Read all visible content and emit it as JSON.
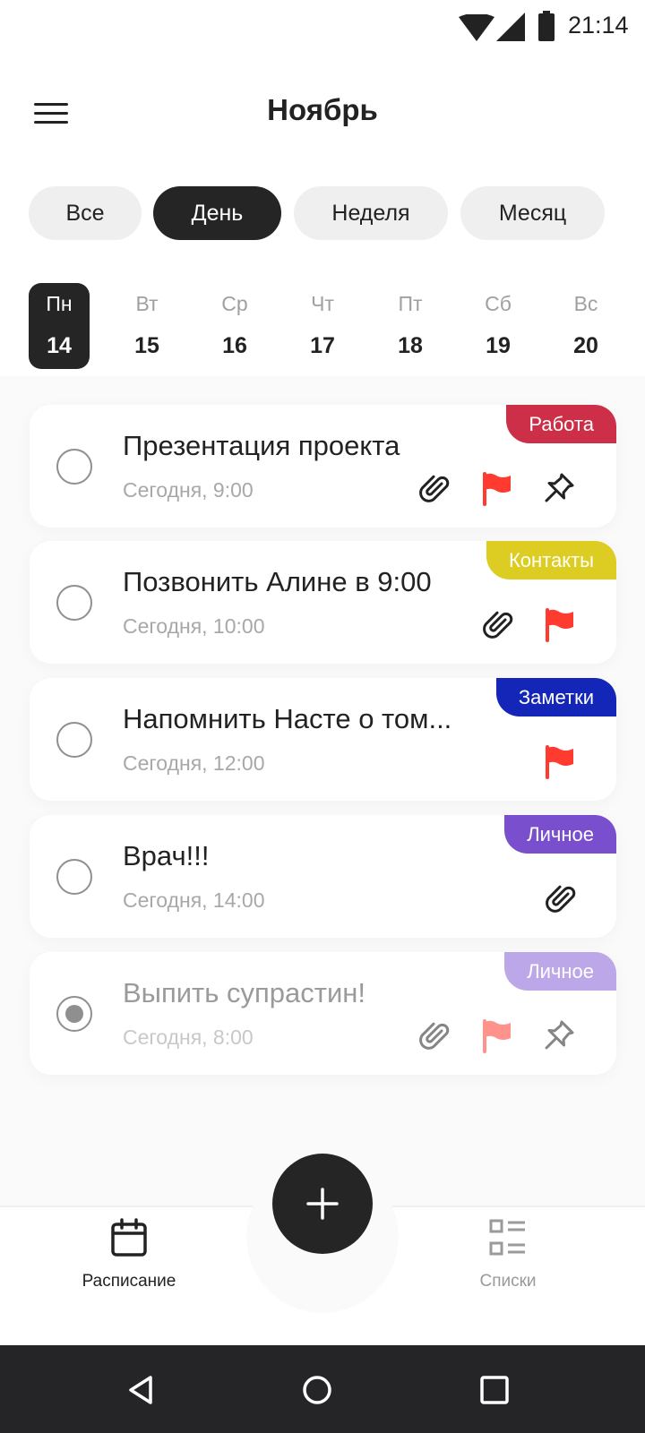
{
  "status_bar": {
    "time": "21:14"
  },
  "header": {
    "title": "Ноябрь"
  },
  "filters": [
    {
      "label": "Все",
      "active": false
    },
    {
      "label": "День",
      "active": true
    },
    {
      "label": "Неделя",
      "active": false
    },
    {
      "label": "Месяц",
      "active": false
    }
  ],
  "week": [
    {
      "name": "Пн",
      "num": "14",
      "active": true
    },
    {
      "name": "Вт",
      "num": "15"
    },
    {
      "name": "Ср",
      "num": "16"
    },
    {
      "name": "Чт",
      "num": "17"
    },
    {
      "name": "Пт",
      "num": "18"
    },
    {
      "name": "Сб",
      "num": "19"
    },
    {
      "name": "Вс",
      "num": "20"
    }
  ],
  "tasks": [
    {
      "title": "Презентация проекта",
      "date": "Сегодня, 9:00",
      "tag": "Работа",
      "tag_color": "#cc2f47",
      "icons": [
        "paperclip-icon",
        "flag-icon",
        "pin-icon"
      ],
      "done": false
    },
    {
      "title": "Позвонить Алине в 9:00",
      "date": "Сегодня, 10:00",
      "tag": "Контакты",
      "tag_color": "#ddcc22",
      "icons": [
        "paperclip-icon",
        "flag-icon"
      ],
      "done": false
    },
    {
      "title": "Напомнить Насте о том...",
      "date": "Сегодня, 12:00",
      "tag": "Заметки",
      "tag_color": "#1426b8",
      "icons": [
        "flag-icon"
      ],
      "done": false
    },
    {
      "title": "Врач!!!",
      "date": "Сегодня, 14:00",
      "tag": "Личное",
      "tag_color": "#7a4fce",
      "icons": [
        "paperclip-icon"
      ],
      "done": false
    },
    {
      "title": "Выпить супрастин!",
      "date": "Сегодня, 8:00",
      "tag": "Личное",
      "tag_color": "#bca8e8",
      "icons": [
        "paperclip-icon",
        "flag-icon",
        "pin-icon"
      ],
      "done": true
    }
  ],
  "bottom_nav": {
    "schedule_label": "Расписание",
    "lists_label": "Списки"
  },
  "colors": {
    "accent_dark": "#252525",
    "flag": "#ff3b30"
  }
}
